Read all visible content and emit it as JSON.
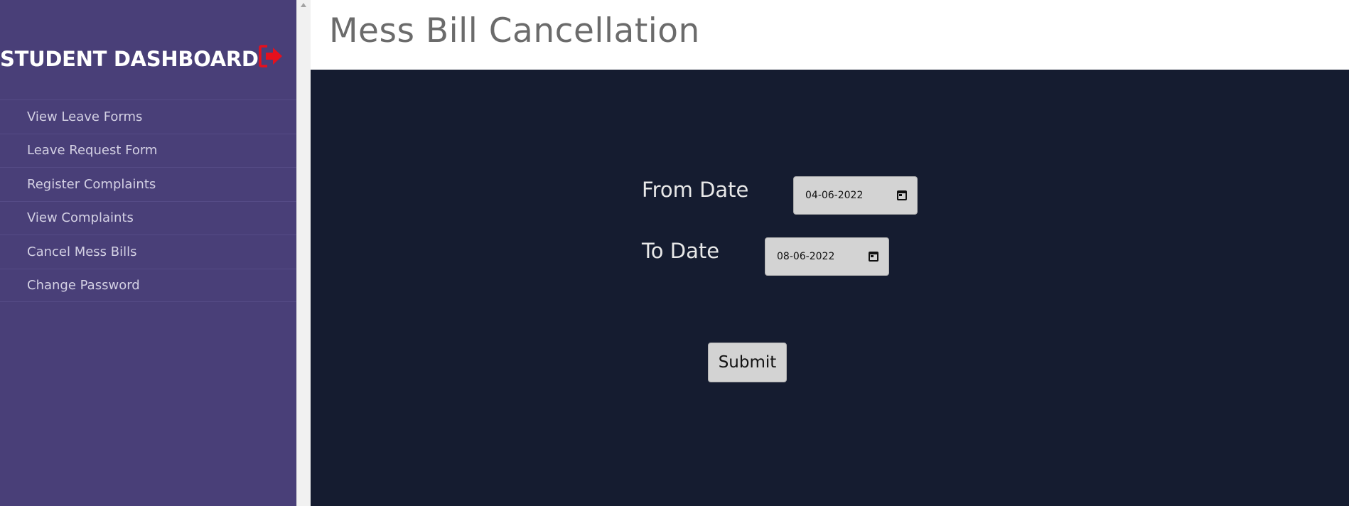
{
  "sidebar": {
    "title": "STUDENT DASHBOARD",
    "logout_icon": "sign-out-icon",
    "logout_color": "#e5101d",
    "items": [
      {
        "label": "View Leave Forms"
      },
      {
        "label": "Leave Request Form"
      },
      {
        "label": "Register Complaints"
      },
      {
        "label": "View Complaints"
      },
      {
        "label": "Cancel Mess Bills"
      },
      {
        "label": "Change Password"
      }
    ]
  },
  "header": {
    "title": "Mess Bill Cancellation"
  },
  "form": {
    "from_label": "From Date",
    "from_value": "04-06-2022",
    "to_label": "To Date",
    "to_value": "08-06-2022",
    "submit_label": "Submit"
  },
  "colors": {
    "sidebar_bg": "#493f78",
    "main_bg": "#151c30",
    "input_bg": "#d3d3d3"
  }
}
